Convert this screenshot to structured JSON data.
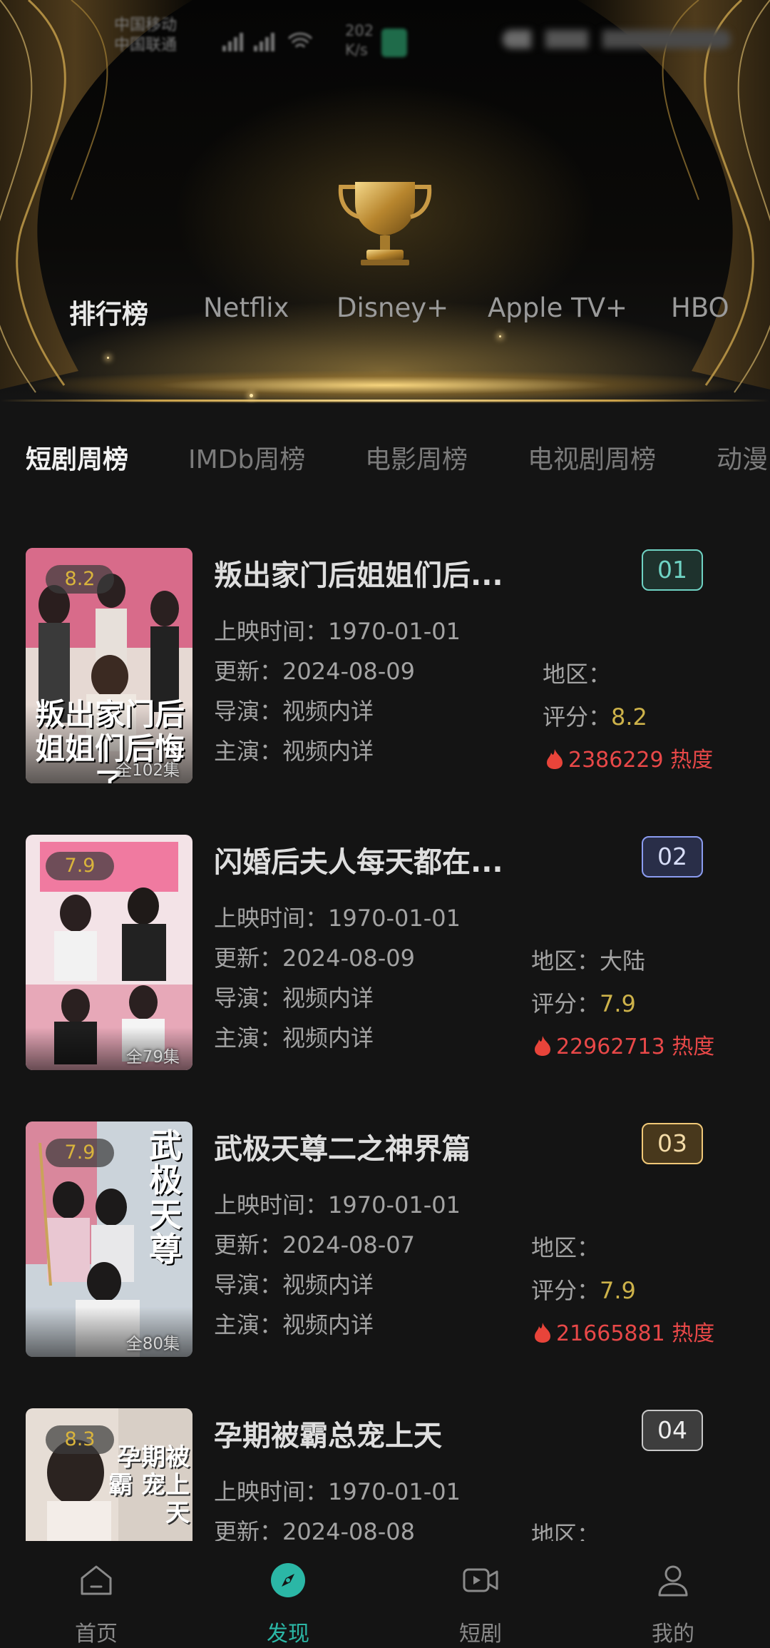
{
  "status_bar": {
    "carrier_line1": "中国移动",
    "carrier_line2": "中国联通",
    "net_speed_value": "202",
    "net_speed_unit": "K/s"
  },
  "platform_tabs": [
    {
      "label": "排行榜",
      "active": true
    },
    {
      "label": "Netflix",
      "active": false
    },
    {
      "label": "Disney+",
      "active": false
    },
    {
      "label": "Apple TV+",
      "active": false
    },
    {
      "label": "HBO",
      "active": false
    }
  ],
  "sub_tabs": [
    {
      "label": "短剧周榜",
      "active": true
    },
    {
      "label": "IMDb周榜",
      "active": false
    },
    {
      "label": "电影周榜",
      "active": false
    },
    {
      "label": "电视剧周榜",
      "active": false
    },
    {
      "label": "动漫",
      "active": false
    }
  ],
  "labels": {
    "release": "上映时间：",
    "update": "更新：",
    "director": "导演：",
    "cast": "主演：",
    "region": "地区：",
    "rating": "评分：",
    "heat_suffix": "热度"
  },
  "items": [
    {
      "rank": "01",
      "rank_color": "#6fd3c4",
      "title": "叛出家门后姐姐们后...",
      "score": "8.2",
      "episodes": "全102集",
      "release_date": "1970-01-01",
      "update_date": "2024-08-09",
      "director": "视频内详",
      "cast": "视频内详",
      "region": "",
      "rating": "8.2",
      "heat": "2386229",
      "poster_text": "叛出家门后 姐姐们后悔了",
      "poster_colors": [
        "#e8d7cf",
        "#7a3a52"
      ]
    },
    {
      "rank": "02",
      "rank_color": "#8b9cf0",
      "title": "闪婚后夫人每天都在...",
      "score": "7.9",
      "episodes": "全79集",
      "release_date": "1970-01-01",
      "update_date": "2024-08-09",
      "director": "视频内详",
      "cast": "视频内详",
      "region": "大陆",
      "rating": "7.9",
      "heat": "22962713",
      "poster_text": "",
      "poster_colors": [
        "#f6e6ea",
        "#e8a8b8"
      ]
    },
    {
      "rank": "03",
      "rank_color": "#f0c878",
      "title": "武极天尊二之神界篇",
      "score": "7.9",
      "episodes": "全80集",
      "release_date": "1970-01-01",
      "update_date": "2024-08-07",
      "director": "视频内详",
      "cast": "视频内详",
      "region": "",
      "rating": "7.9",
      "heat": "21665881",
      "poster_text": "武极天尊",
      "poster_colors": [
        "#cfd6dc",
        "#6a7f92"
      ]
    },
    {
      "rank": "04",
      "rank_color": "#c8c8c8",
      "title": "孕期被霸总宠上天",
      "score": "8.3",
      "episodes": "",
      "release_date": "1970-01-01",
      "update_date": "2024-08-08",
      "director": "",
      "cast": "",
      "region": "",
      "rating": "",
      "heat": "",
      "poster_text": "孕期被霸 宠上天",
      "poster_colors": [
        "#e4ddd6",
        "#8a7a6c"
      ]
    }
  ],
  "bottom_nav": [
    {
      "label": "首页",
      "icon": "home-icon",
      "active": false
    },
    {
      "label": "发现",
      "icon": "discover-compass-icon",
      "active": true
    },
    {
      "label": "短剧",
      "icon": "short-video-icon",
      "active": false
    },
    {
      "label": "我的",
      "icon": "profile-icon",
      "active": false
    }
  ],
  "colors": {
    "accent": "#2bb7a6",
    "gold_score": "#d9b43c",
    "heat_red": "#e84848",
    "background": "#141414"
  }
}
